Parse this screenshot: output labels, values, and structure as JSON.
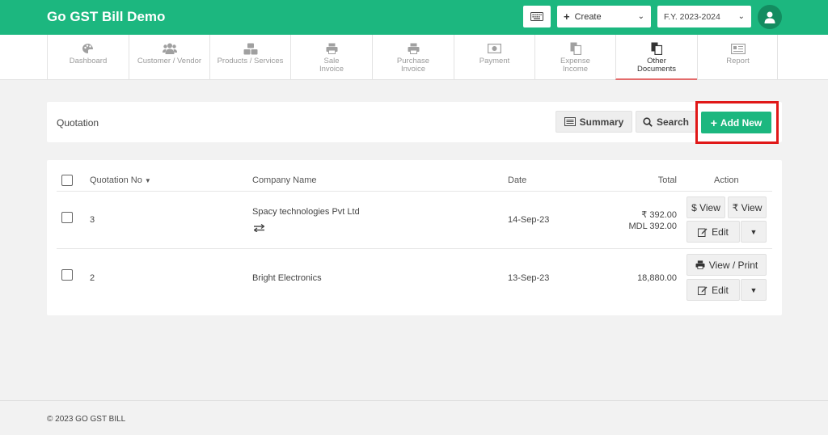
{
  "app": {
    "title": "Go GST Bill Demo"
  },
  "header": {
    "create_label": "Create",
    "fy_label": "F.Y. 2023-2024"
  },
  "nav": {
    "items": [
      {
        "label": "Dashboard",
        "icon": "palette-icon"
      },
      {
        "label": "Customer / Vendor",
        "icon": "users-icon"
      },
      {
        "label": "Products / Services",
        "icon": "cubes-icon"
      },
      {
        "label": "Sale\nInvoice",
        "icon": "printer-icon"
      },
      {
        "label": "Purchase\nInvoice",
        "icon": "printer-icon"
      },
      {
        "label": "Payment",
        "icon": "money-icon"
      },
      {
        "label": "Expense\nIncome",
        "icon": "copy-icon"
      },
      {
        "label": "Other\nDocuments",
        "icon": "copy-icon",
        "active": true
      },
      {
        "label": "Report",
        "icon": "report-icon"
      }
    ]
  },
  "toolbar": {
    "title": "Quotation",
    "summary_label": "Summary",
    "search_label": "Search",
    "add_label": "Add New"
  },
  "table": {
    "headers": {
      "quotation_no": "Quotation No",
      "company": "Company Name",
      "date": "Date",
      "total": "Total",
      "action": "Action"
    },
    "rows": [
      {
        "no": "3",
        "company": "Spacy technologies Pvt Ltd",
        "date": "14-Sep-23",
        "total_line1": "₹ 392.00",
        "total_line2": "MDL 392.00",
        "btn_dollar_view": "$ View",
        "btn_rupee_view": "₹ View",
        "btn_edit": "Edit"
      },
      {
        "no": "2",
        "company": "Bright Electronics",
        "date": "13-Sep-23",
        "total_line1": "18,880.00",
        "btn_view_print": "View / Print",
        "btn_edit": "Edit"
      }
    ]
  },
  "footer": {
    "text": "© 2023 GO GST BILL"
  },
  "colors": {
    "brand": "#1cb77f",
    "highlight": "#e01818",
    "active_underline": "#e36b6b"
  }
}
